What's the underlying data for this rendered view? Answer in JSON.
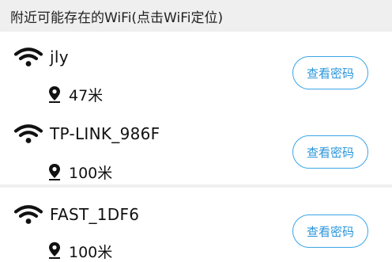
{
  "header": {
    "title": "附近可能存在的WiFi(点击WiFi定位)"
  },
  "networks": [
    {
      "ssid": "jly",
      "distance": "47米",
      "button_label": "查看密码"
    },
    {
      "ssid": "TP-LINK_986F",
      "distance": "100米",
      "button_label": "查看密码"
    },
    {
      "ssid": "FAST_1DF6",
      "distance": "100米",
      "button_label": "查看密码"
    }
  ],
  "icons": {
    "wifi": "wifi-icon",
    "location": "location-pin-icon"
  },
  "colors": {
    "accent": "#39a6e6",
    "button_text": "#2a96da",
    "header_bg": "#efefef",
    "separator": "#efefef",
    "text": "#111111"
  }
}
